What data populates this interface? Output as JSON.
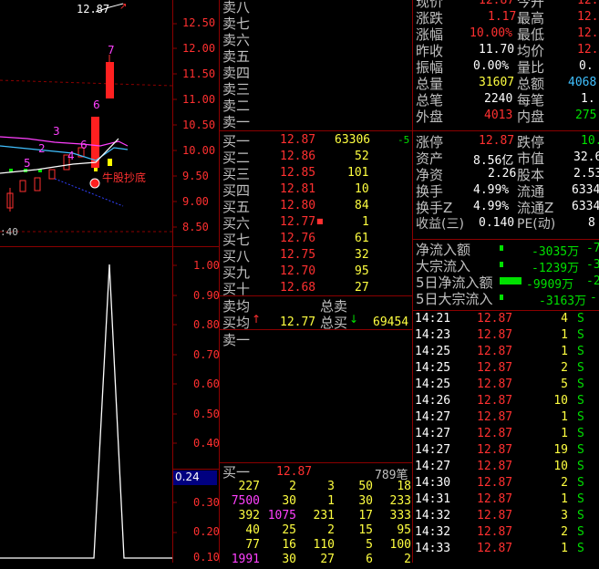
{
  "chart": {
    "top_label": "12.87",
    "price_ticks": [
      "12.50",
      "12.00",
      "11.50",
      "11.00",
      "10.50",
      "10.00",
      "9.50",
      "9.00",
      "8.50"
    ],
    "time_label": ":40",
    "candle_numbers": [
      "7",
      "6",
      "3",
      "2",
      "4",
      "5",
      "6"
    ],
    "signal_text": "牛股抄底",
    "ind_ticks": [
      "1.00",
      "0.90",
      "0.80",
      "0.70",
      "0.60",
      "0.50",
      "0.40",
      "0.30",
      "0.20",
      "0.10"
    ],
    "ind_value": "0.24"
  },
  "sell": [
    {
      "label": "卖八",
      "price": "",
      "vol": ""
    },
    {
      "label": "卖七",
      "price": "",
      "vol": ""
    },
    {
      "label": "卖六",
      "price": "",
      "vol": ""
    },
    {
      "label": "卖五",
      "price": "",
      "vol": ""
    },
    {
      "label": "卖四",
      "price": "",
      "vol": ""
    },
    {
      "label": "卖三",
      "price": "",
      "vol": ""
    },
    {
      "label": "卖二",
      "price": "",
      "vol": ""
    },
    {
      "label": "卖一",
      "price": "",
      "vol": ""
    }
  ],
  "buy": [
    {
      "label": "买一",
      "price": "12.87",
      "vol": "63306",
      "chg": "-5"
    },
    {
      "label": "买二",
      "price": "12.86",
      "vol": "52",
      "chg": ""
    },
    {
      "label": "买三",
      "price": "12.85",
      "vol": "101",
      "chg": ""
    },
    {
      "label": "买四",
      "price": "12.81",
      "vol": "10",
      "chg": ""
    },
    {
      "label": "买五",
      "price": "12.80",
      "vol": "84",
      "chg": ""
    },
    {
      "label": "买六",
      "price": "12.77",
      "vol": "1",
      "chg": ""
    },
    {
      "label": "买七",
      "price": "12.76",
      "vol": "61",
      "chg": ""
    },
    {
      "label": "买八",
      "price": "12.75",
      "vol": "32",
      "chg": ""
    },
    {
      "label": "买九",
      "price": "12.70",
      "vol": "95",
      "chg": ""
    },
    {
      "label": "买十",
      "price": "12.68",
      "vol": "27",
      "chg": ""
    }
  ],
  "summary": {
    "sell_avg_label": "卖均",
    "total_sell_label": "总卖",
    "buy_avg_label": "买均",
    "buy_avg": "12.77",
    "total_buy_label": "总买",
    "total_buy": "69454",
    "queue_label": "卖一"
  },
  "queue": {
    "label": "买一",
    "price": "12.87",
    "count": "789笔",
    "rows": [
      [
        "227",
        "2",
        "3",
        "50",
        "18"
      ],
      [
        "7500",
        "30",
        "1",
        "30",
        "233"
      ],
      [
        "392",
        "1075",
        "231",
        "17",
        "333"
      ],
      [
        "40",
        "25",
        "2",
        "15",
        "95"
      ],
      [
        "77",
        "16",
        "110",
        "5",
        "100"
      ],
      [
        "1991",
        "30",
        "27",
        "6",
        "2"
      ]
    ]
  },
  "stats_top": [
    {
      "l1": "现价",
      "v1": "12.87",
      "l2": "今开",
      "v2": "12."
    },
    {
      "l1": "涨跌",
      "v1": "1.17",
      "l2": "最高",
      "v2": "12."
    },
    {
      "l1": "涨幅",
      "v1": "10.00%",
      "l2": "最低",
      "v2": "12."
    },
    {
      "l1": "昨收",
      "v1": "11.70",
      "l2": "均价",
      "v2": "12."
    },
    {
      "l1": "振幅",
      "v1": "0.00%",
      "l2": "量比",
      "v2": "0."
    },
    {
      "l1": "总量",
      "v1": "31607",
      "l2": "总额",
      "v2": "4068"
    },
    {
      "l1": "总笔",
      "v1": "2240",
      "l2": "每笔",
      "v2": "1."
    },
    {
      "l1": "外盘",
      "v1": "4013",
      "l2": "内盘",
      "v2": "275"
    }
  ],
  "stats_bottom": [
    {
      "l1": "涨停",
      "v1": "12.87",
      "l2": "跌停",
      "v2": "10."
    },
    {
      "l1": "资产",
      "v1": "8.56亿",
      "l2": "市值",
      "v2": "32.6"
    },
    {
      "l1": "净资",
      "v1": "2.26",
      "l2": "股本",
      "v2": "2.53"
    },
    {
      "l1": "换手",
      "v1": "4.99%",
      "l2": "流通",
      "v2": "6334"
    },
    {
      "l1": "换手Z",
      "v1": "4.99%",
      "l2": "流通Z",
      "v2": "6334"
    },
    {
      "l1": "收益(三)",
      "v1": "0.140",
      "l2": "PE(动)",
      "v2": "8"
    }
  ],
  "flows": [
    {
      "label": "净流入额",
      "value": "-3035万",
      "extra": "-7"
    },
    {
      "label": "大宗流入",
      "value": "-1239万",
      "extra": "-3"
    },
    {
      "label": "5日净流入额",
      "value": "-9909万",
      "extra": "-2"
    },
    {
      "label": "5日大宗流入",
      "value": "-3163万",
      "extra": "-"
    }
  ],
  "ticks": [
    {
      "time": "14:21",
      "price": "12.87",
      "vol": "4",
      "bs": "S"
    },
    {
      "time": "14:23",
      "price": "12.87",
      "vol": "1",
      "bs": "S"
    },
    {
      "time": "14:25",
      "price": "12.87",
      "vol": "1",
      "bs": "S"
    },
    {
      "time": "14:25",
      "price": "12.87",
      "vol": "2",
      "bs": "S"
    },
    {
      "time": "14:25",
      "price": "12.87",
      "vol": "5",
      "bs": "S"
    },
    {
      "time": "14:26",
      "price": "12.87",
      "vol": "10",
      "bs": "S"
    },
    {
      "time": "14:27",
      "price": "12.87",
      "vol": "1",
      "bs": "S"
    },
    {
      "time": "14:27",
      "price": "12.87",
      "vol": "1",
      "bs": "S"
    },
    {
      "time": "14:27",
      "price": "12.87",
      "vol": "19",
      "bs": "S"
    },
    {
      "time": "14:27",
      "price": "12.87",
      "vol": "10",
      "bs": "S"
    },
    {
      "time": "14:30",
      "price": "12.87",
      "vol": "2",
      "bs": "S"
    },
    {
      "time": "14:31",
      "price": "12.87",
      "vol": "1",
      "bs": "S"
    },
    {
      "time": "14:32",
      "price": "12.87",
      "vol": "3",
      "bs": "S"
    },
    {
      "time": "14:32",
      "price": "12.87",
      "vol": "2",
      "bs": "S"
    },
    {
      "time": "14:33",
      "price": "12.87",
      "vol": "1",
      "bs": "S"
    }
  ]
}
